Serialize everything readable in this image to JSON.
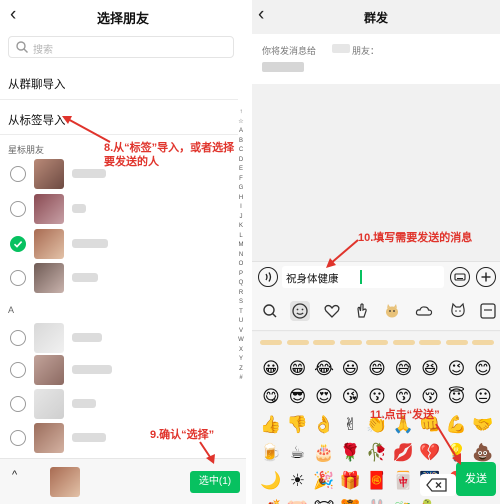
{
  "left": {
    "title": "选择朋友",
    "back_glyph": "‹",
    "search_placeholder": "搜索",
    "menu": [
      {
        "label": "从群聊导入"
      },
      {
        "label": "从标签导入"
      }
    ],
    "section_starred": "星标朋友",
    "section_a": "A",
    "az_index": [
      "↑",
      "☆",
      "A",
      "B",
      "C",
      "D",
      "E",
      "F",
      "G",
      "H",
      "I",
      "J",
      "K",
      "L",
      "M",
      "N",
      "O",
      "P",
      "Q",
      "R",
      "S",
      "T",
      "U",
      "V",
      "W",
      "X",
      "Y",
      "Z",
      "#"
    ],
    "contacts_starred": [
      {
        "checked": false
      },
      {
        "checked": false
      },
      {
        "checked": true
      },
      {
        "checked": false
      }
    ],
    "contacts_a": [
      {
        "checked": false
      },
      {
        "checked": false
      },
      {
        "checked": false
      },
      {
        "checked": false
      }
    ],
    "bottom": {
      "up_glyph": "^",
      "confirm_label": "选中(1)"
    }
  },
  "right": {
    "title": "群发",
    "back_glyph": "‹",
    "recipient_prefix": "你将发消息给",
    "recipient_suffix": "朋友：",
    "message_text": "祝身体健康",
    "send_label": "发送",
    "emoji_rows": [
      [
        "😀",
        "😁",
        "😂",
        "😃",
        "😄",
        "😅",
        "😆",
        "😉",
        "😊"
      ],
      [
        "😋",
        "😎",
        "😍",
        "😘",
        "😗",
        "😙",
        "😚",
        "😇",
        "😐"
      ],
      [
        "👍",
        "👎",
        "👌",
        "✌",
        "👏",
        "🙏",
        "👊",
        "💪",
        "🤝"
      ],
      [
        "🍺",
        "☕",
        "🎂",
        "🌹",
        "🥀",
        "💋",
        "💔",
        "💡",
        "💩"
      ],
      [
        "🌙",
        "☀",
        "🎉",
        "🎁",
        "🧧",
        "🀄",
        "🎆",
        "🎈",
        "✨"
      ],
      [
        "🧨",
        "🐷",
        "🐮",
        "🐯",
        "🐰",
        "🐲",
        "🐍",
        "",
        ""
      ]
    ]
  },
  "annotations": {
    "step8": "8.从“标签”导入，或者选择要发送的人",
    "step9": "9.确认“选择”",
    "step10": "10.填写需要发送的消息",
    "step11": "11.点击“发送”"
  },
  "colors": {
    "brand_green": "#07c160",
    "annotation_red": "#e0342c"
  }
}
